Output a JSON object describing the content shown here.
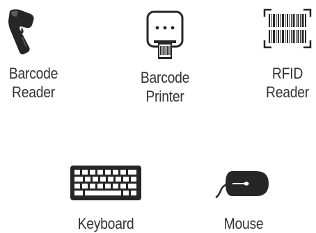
{
  "devices": [
    {
      "id": "barcode-reader",
      "icon": "barcode-scanner-icon",
      "label_lines": [
        "Barcode",
        "Reader"
      ]
    },
    {
      "id": "barcode-printer",
      "icon": "printer-icon",
      "label_lines": [
        "Barcode",
        "Printer"
      ]
    },
    {
      "id": "rfid-reader",
      "icon": "barcode-icon",
      "label_lines": [
        "RFID",
        "Reader"
      ]
    },
    {
      "id": "keyboard",
      "icon": "keyboard-icon",
      "label_lines": [
        "Keyboard"
      ]
    },
    {
      "id": "mouse",
      "icon": "mouse-icon",
      "label_lines": [
        "Mouse"
      ]
    }
  ],
  "colors": {
    "icon": "#262626",
    "text": "#333333"
  }
}
